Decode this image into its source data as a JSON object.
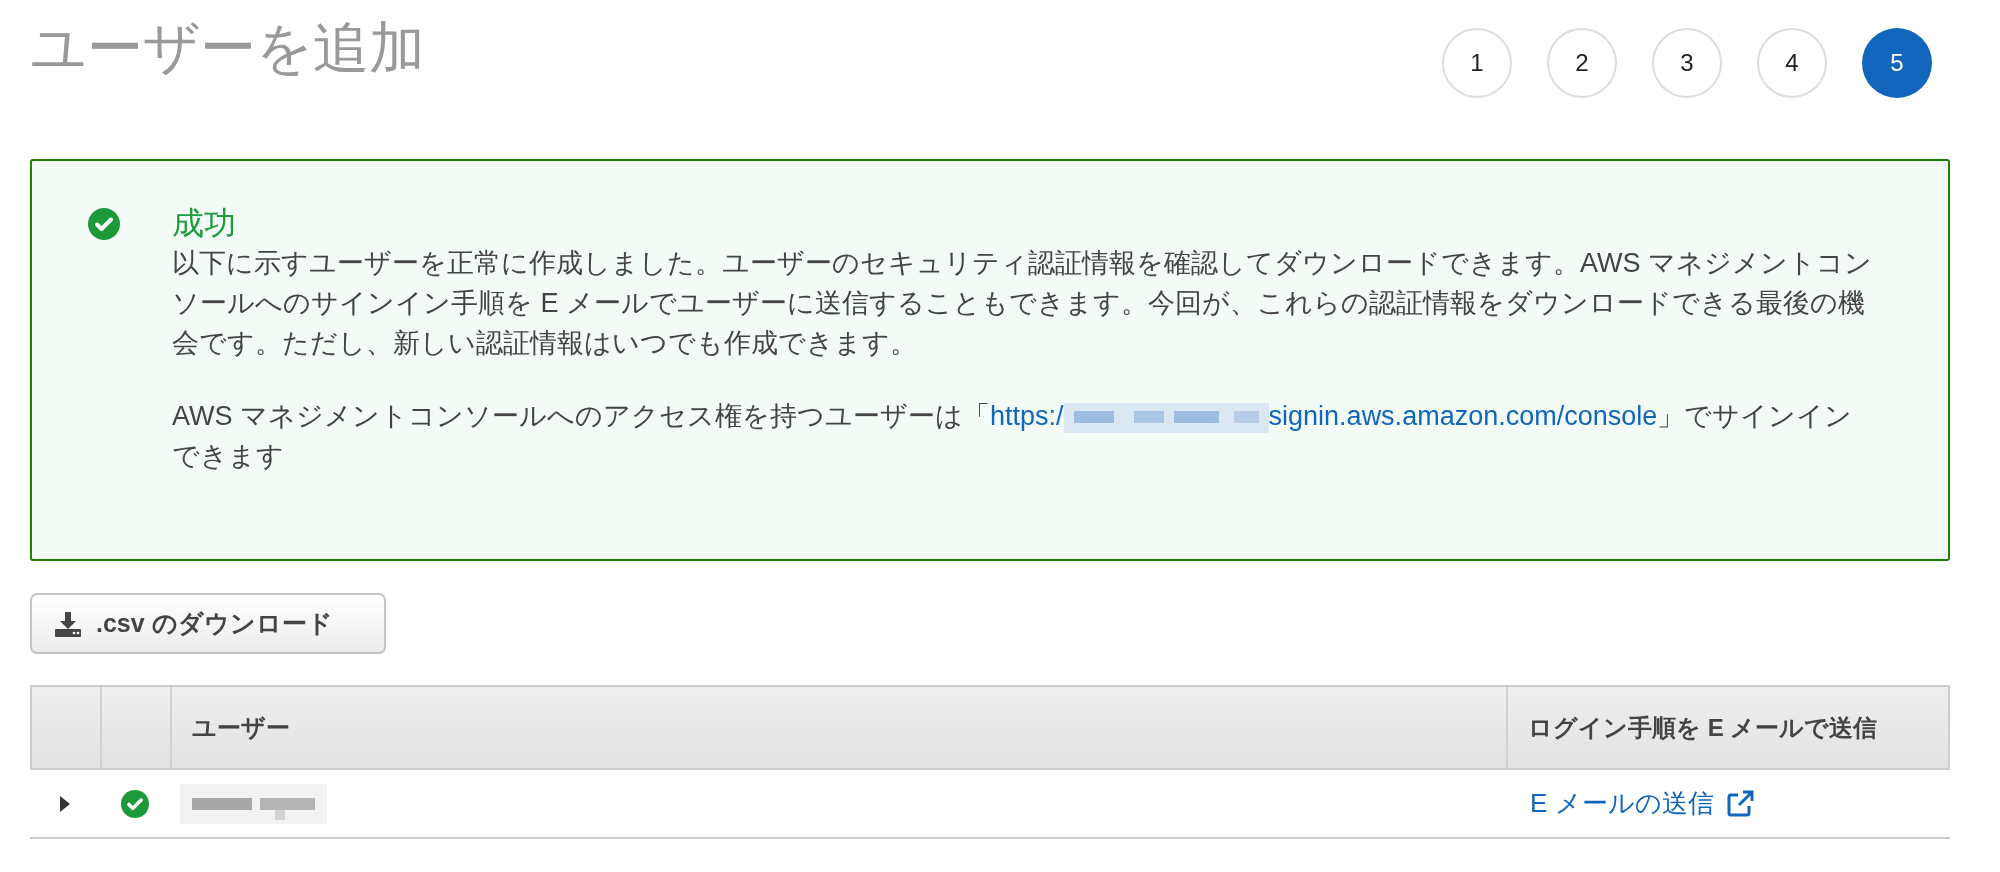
{
  "page_title": "ユーザーを追加",
  "steps": [
    {
      "label": "1",
      "selected": false
    },
    {
      "label": "2",
      "selected": false
    },
    {
      "label": "3",
      "selected": false
    },
    {
      "label": "4",
      "selected": false
    },
    {
      "label": "5",
      "selected": true
    }
  ],
  "alert": {
    "title": "成功",
    "message": "以下に示すユーザーを正常に作成しました。ユーザーのセキュリティ認証情報を確認してダウンロードできます。AWS マネジメントコンソールへのサインイン手順を E メールでユーザーに送信することもできます。今回が、これらの認証情報をダウンロードできる最後の機会です。ただし、新しい認証情報はいつでも作成できます。",
    "access_text_before": "AWS マネジメントコンソールへのアクセス権を持つユーザーは「",
    "link_start": "https:/",
    "link_end": "signin.aws.amazon.com/console",
    "access_text_after": "」でサインインできます"
  },
  "download_button": ".csv のダウンロード",
  "table": {
    "columns": [
      "ユーザー",
      "ログイン手順を E メールで送信"
    ],
    "rows": [
      {
        "expanded": false,
        "email_link": "E メールの送信"
      }
    ]
  }
}
